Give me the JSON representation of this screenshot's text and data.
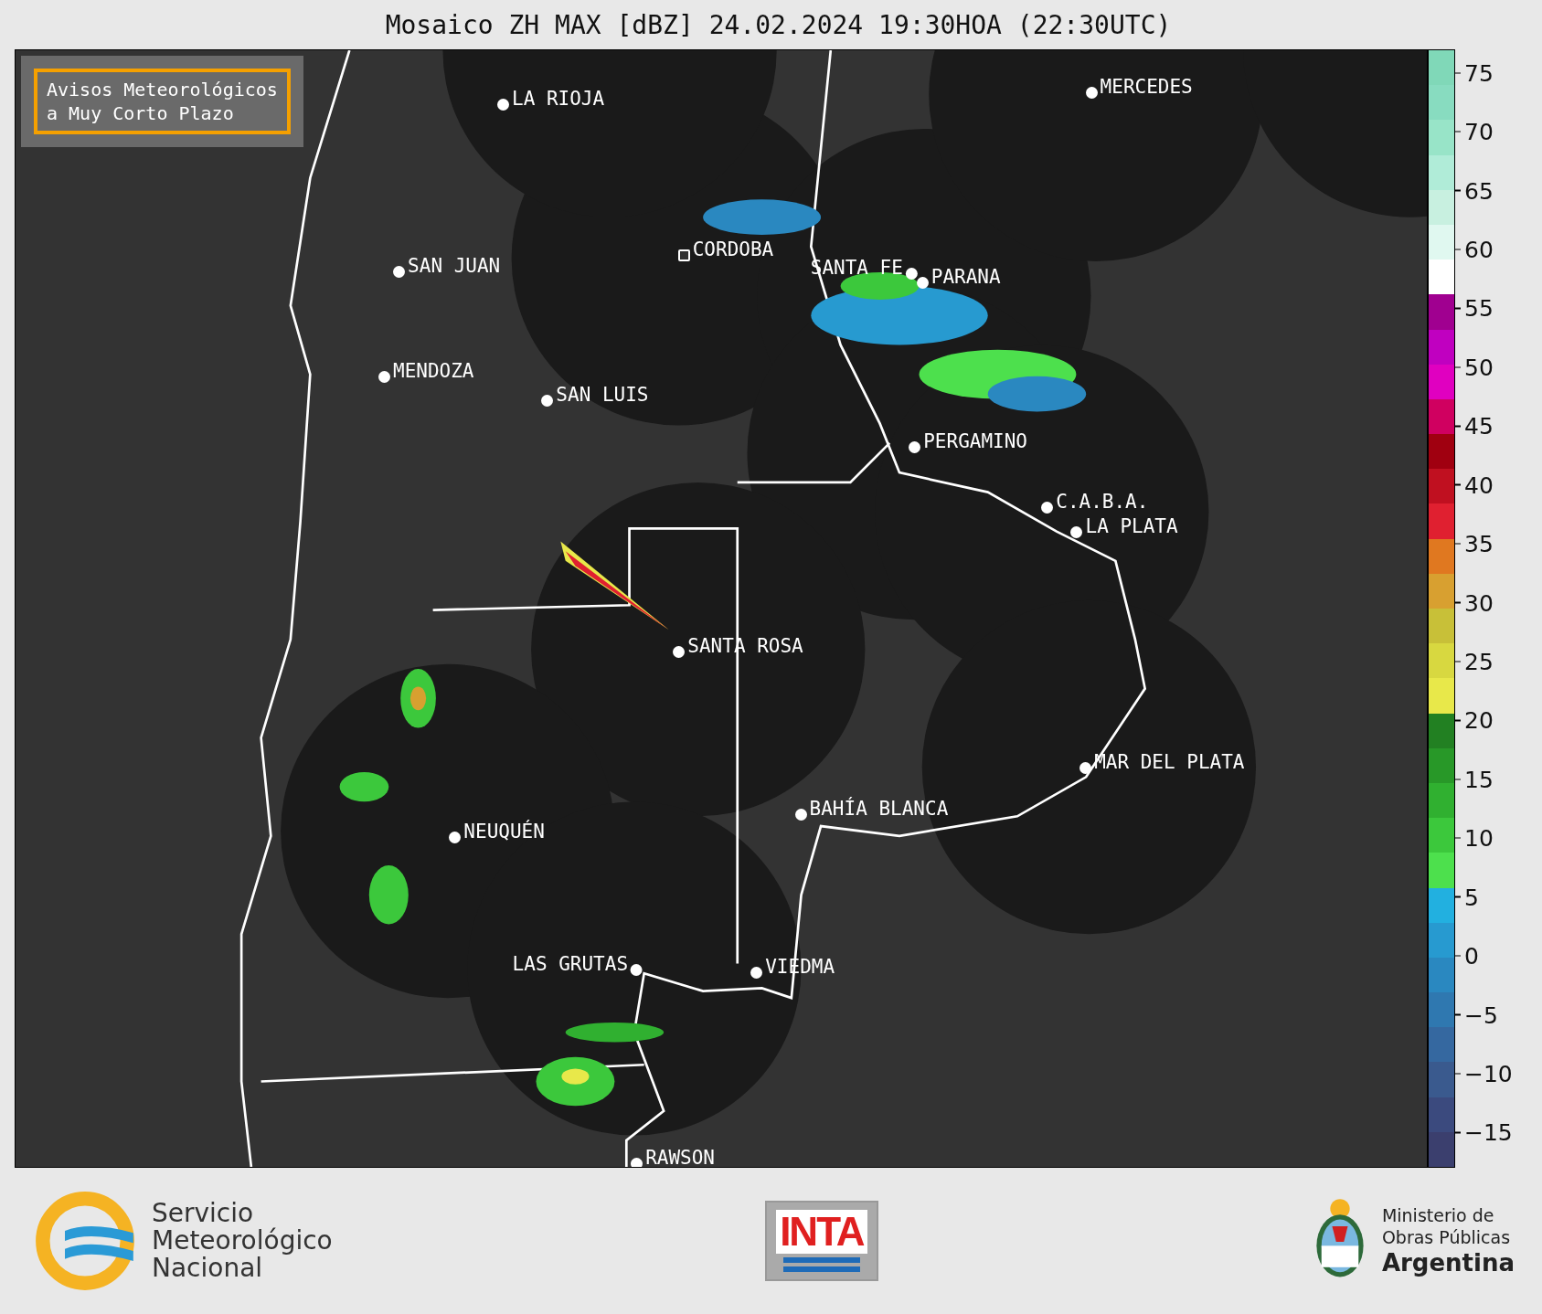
{
  "title": "Mosaico ZH MAX [dBZ] 24.02.2024 19:30HOA (22:30UTC)",
  "notice": [
    "Avisos Meteorológicos",
    "a Muy Corto Plazo"
  ],
  "cities": [
    {
      "name": "LA RIOJA",
      "kind": "dot"
    },
    {
      "name": "SAN JUAN",
      "kind": "dot"
    },
    {
      "name": "CORDOBA",
      "kind": "radar"
    },
    {
      "name": "SANTA FE",
      "kind": "dot"
    },
    {
      "name": "PARANA",
      "kind": "dot"
    },
    {
      "name": "MERCEDES",
      "kind": "dot"
    },
    {
      "name": "MENDOZA",
      "kind": "dot"
    },
    {
      "name": "SAN LUIS",
      "kind": "dot"
    },
    {
      "name": "PERGAMINO",
      "kind": "dot"
    },
    {
      "name": "C.A.B.A.",
      "kind": "dot"
    },
    {
      "name": "LA PLATA",
      "kind": "dot"
    },
    {
      "name": "SANTA ROSA",
      "kind": "dot"
    },
    {
      "name": "MAR DEL PLATA",
      "kind": "dot"
    },
    {
      "name": "BAHÍA BLANCA",
      "kind": "dot"
    },
    {
      "name": "NEUQUÉN",
      "kind": "dot"
    },
    {
      "name": "LAS GRUTAS",
      "kind": "dot"
    },
    {
      "name": "VIEDMA",
      "kind": "dot"
    },
    {
      "name": "RAWSON",
      "kind": "dot"
    }
  ],
  "colorbar_ticks": [
    "75",
    "70",
    "65",
    "60",
    "55",
    "50",
    "45",
    "40",
    "35",
    "30",
    "25",
    "20",
    "15",
    "10",
    "5",
    "0",
    "−5",
    "−10",
    "−15"
  ],
  "footer": {
    "smn": [
      "Servicio",
      "Meteorológico",
      "Nacional"
    ],
    "inta": "INTA",
    "ministry": [
      "Ministerio de",
      "Obras Públicas",
      "Argentina"
    ]
  }
}
